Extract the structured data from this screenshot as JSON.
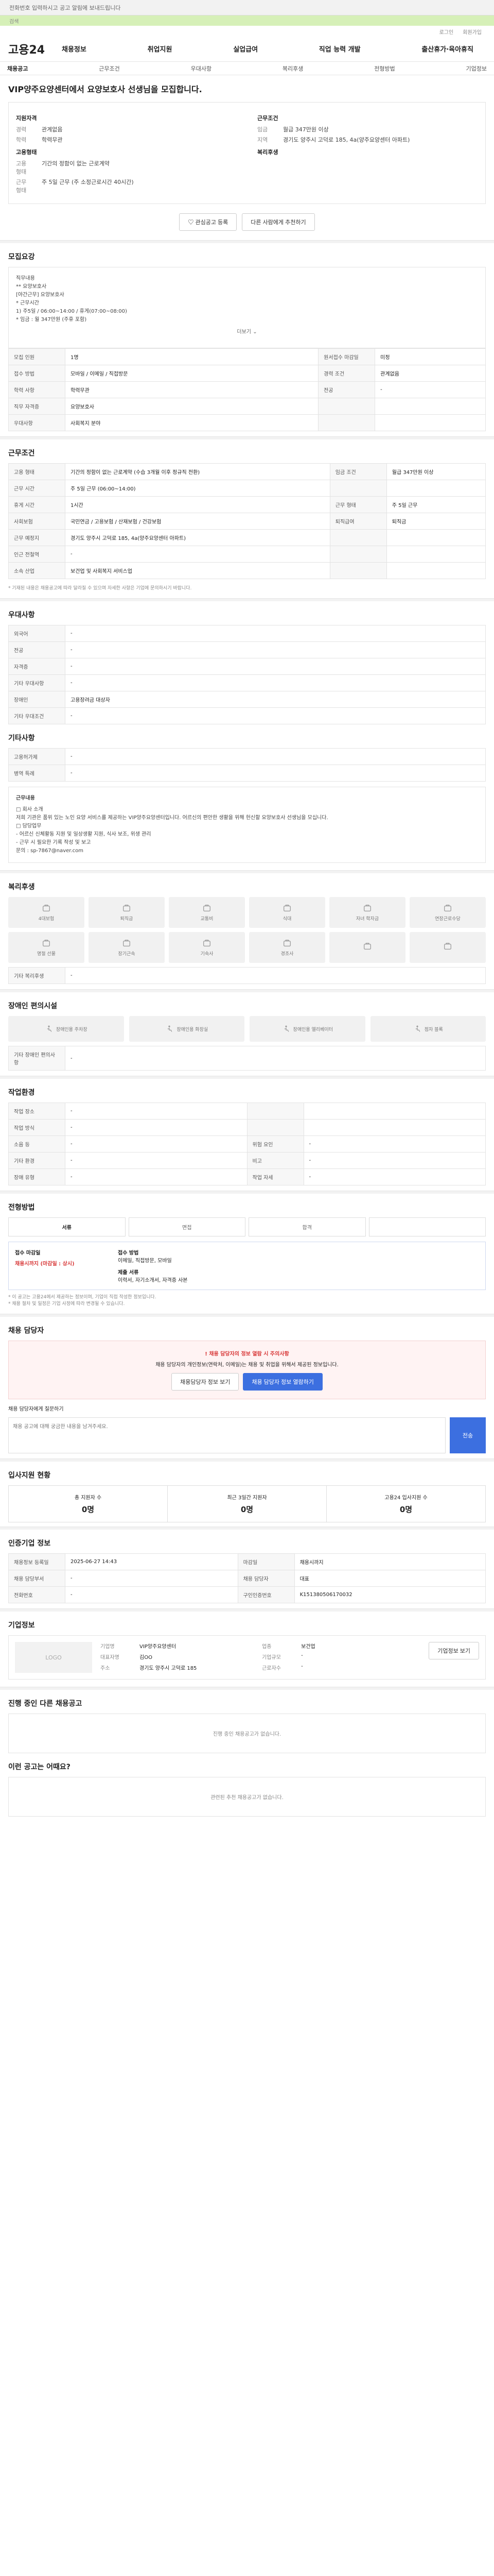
{
  "top": {
    "notice": "전화번호 입력하시고 공고 알림에 보내드립니다",
    "search": "검색"
  },
  "util": [
    "로그인",
    "회원가입"
  ],
  "logo": "고용24",
  "nav": [
    "채용정보",
    "취업지원",
    "실업급여",
    "직업 능력 개발",
    "출산휴가·육아휴직"
  ],
  "tabs": [
    "채용공고",
    "근무조건",
    "우대사항",
    "복리후생",
    "전형방법",
    "기업정보"
  ],
  "job_title": "VIP양주요양센터에서 요양보호사 선생님을 모집합니다.",
  "summary": {
    "left_title": "지원자격",
    "experience_k": "경력",
    "experience": "관계없음",
    "edu_k": "학력",
    "edu": "학력무관",
    "left_title2": "고용형태",
    "type_k": "고용형태",
    "type": "기간의 정함이 없는 근로계약",
    "work_k": "근무형태",
    "work": "주 5일 근무 (주 소정근로시간 40시간)",
    "right_title": "근무조건",
    "wage_k": "임금",
    "wage": "월급 347만원 이상",
    "loc_k": "지역",
    "loc": "경기도 양주시 고덕로 185, 4a(양주요양센터 아파트)",
    "right_title2": "복리후생"
  },
  "actions": {
    "apply": "관심공고 등록",
    "sns": "다른 사람에게 추천하기"
  },
  "recruit": {
    "h": "모집요강",
    "desc": [
      "직무내용",
      "** 요양보호사",
      "[야간근무] 요양보호사",
      "",
      "* 근무시간",
      "1) 주5일 / 06:00~14:00 / 휴게(07:00~08:00)",
      "* 임금 : 월 347만원 (주휴 포함)"
    ],
    "more": "더보기",
    "rows": [
      [
        "모집 인원",
        "1명",
        "원서접수 마감일",
        "미정"
      ],
      [
        "접수 방법",
        "모바일 / 이메일 / 직접방문",
        "경력 조건",
        "관계없음"
      ],
      [
        "학력 사항",
        "학력무관",
        "전공",
        "-"
      ],
      [
        "직무 자격증",
        "요양보호사",
        "",
        ""
      ],
      [
        "우대사항",
        "사회복지 분야",
        "",
        ""
      ]
    ]
  },
  "condition": {
    "h": "근무조건",
    "rows": [
      [
        "고용 형태",
        "기간의 정함이 없는 근로계약 (수습 3개월 이후 정규직 전환)",
        "임금 조건",
        "월급 347만원 이상"
      ],
      [
        "근무 시간",
        "주 5일 근무 (06:00~14:00)",
        "",
        ""
      ],
      [
        "휴게 시간",
        "1시간",
        "근무 형태",
        "주 5일 근무"
      ],
      [
        "사회보험",
        "국민연금 / 고용보험 / 산재보험 / 건강보험",
        "퇴직급여",
        "퇴직금"
      ],
      [
        "근무 예정지",
        "경기도 양주시 고덕로 185, 4a(양주요양센터 아파트)",
        "",
        ""
      ],
      [
        "인근 전철역",
        "-",
        "",
        ""
      ],
      [
        "소속 산업",
        "보건업 및 사회복지 서비스업",
        "",
        ""
      ]
    ],
    "note": "* 기재된 내용은 채용공고에 따라 달라질 수 있으며 자세한 사항은 기업에 문의하시기 바랍니다."
  },
  "pref": {
    "h": "우대사항",
    "rows": [
      [
        "외국어",
        "-"
      ],
      [
        "전공",
        "-"
      ],
      [
        "자격증",
        "-"
      ],
      [
        "기타 우대사항",
        "-"
      ],
      [
        "장애인",
        "고용장려금 대상자"
      ],
      [
        "기타 우대조건",
        "-"
      ]
    ]
  },
  "etc": {
    "h": "기타사항",
    "rows": [
      [
        "고용허가제",
        "-"
      ],
      [
        "병역 특례",
        "-"
      ]
    ]
  },
  "detail": {
    "title": "근무내용",
    "text": [
      "□ 회사 소개",
      "저희 기관은 품위 있는 노인 요양 서비스를 제공하는 VIP양주요양센터입니다. 어르신의 편안한 생활을 위해 헌신할 요양보호사 선생님을 모십니다.",
      "□ 담당업무",
      "- 어르신 신체활동 지원 및 일상생활 지원, 식사 보조, 위생 관리",
      "- 근무 시 필요한 기록 작성 및 보고",
      "문의 : sp-7867@naver.com"
    ]
  },
  "welfare": {
    "h": "복리후생",
    "items": [
      "4대보험",
      "퇴직금",
      "교통비",
      "식대",
      "자녀 학자금",
      "연장근로수당",
      "명절 선물",
      "장기근속",
      "기숙사",
      "경조사",
      "",
      ""
    ],
    "etc_k": "기타 복리후생",
    "etc_v": "-"
  },
  "disabled": {
    "h": "장애인 편의시설",
    "items": [
      "장애인용 주차장",
      "장애인용 화장실",
      "장애인용 엘리베이터",
      "점자 블록"
    ],
    "etc_k": "기타 장애인 편의사항",
    "etc_v": "-"
  },
  "working": {
    "h": "작업환경",
    "rows": [
      [
        "작업 장소",
        "-",
        "",
        ""
      ],
      [
        "작업 방식",
        "-",
        "",
        ""
      ],
      [
        "소음 등",
        "-",
        "위험 요인",
        "-"
      ],
      [
        "기타 환경",
        "-",
        "비고",
        "-"
      ],
      [
        "장애 유형",
        "-",
        "작업 자세",
        "-"
      ]
    ]
  },
  "selection": {
    "h": "전형방법",
    "steps": [
      "서류",
      "면접",
      "합격",
      ""
    ],
    "deadline_k": "접수 마감일",
    "deadline": "채용시까지 (마감일 : 상시)",
    "method_k": "접수 방법",
    "method": "이메일, 직접방문, 모바일",
    "submit_k": "제출 서류",
    "submit": "이력서, 자기소개서, 자격증 사본",
    "notes": [
      "* 이 공고는 고용24에서 제공하는 정보이며, 기업이 직접 작성한 정보입니다.",
      "* 채용 절차 및 일정은 기업 사정에 따라 변경될 수 있습니다."
    ]
  },
  "contact": {
    "h": "채용 담당자",
    "warn_title": "채용 담당자의 정보 열람 시 주의사항",
    "warn_text": "채용 담당자의 개인정보(연락처, 이메일)는 채용 및 취업을 위해서 제공된 정보입니다.",
    "btn1": "채용담당자 정보 보기",
    "btn2": "채용 담당자 정보 열람하기",
    "inq_label": "채용 담당자에게 질문하기",
    "inq_ph": "채용 공고에 대해 궁금한 내용을 남겨주세요.",
    "send": "전송"
  },
  "stats": {
    "h": "입사지원 현황",
    "a": [
      "총 지원자 수",
      "0명"
    ],
    "b": [
      "최근 3일간 지원자",
      "0명"
    ],
    "c": [
      "고용24 입사지원 수",
      "0명"
    ]
  },
  "reg": {
    "h": "인증기업 정보",
    "rows": [
      [
        "채용정보 등록일",
        "2025-06-27 14:43",
        "마감일",
        "채용시까지"
      ],
      [
        "채용 담당부서",
        "-",
        "채용 담당자",
        "대표"
      ],
      [
        "전화번호",
        "-",
        "구인인증번호",
        "K151380506170032"
      ]
    ]
  },
  "company": {
    "h": "기업정보",
    "logo": "LOGO",
    "rows": [
      [
        "기업명",
        "VIP양주요양센터",
        "업종",
        "보건업"
      ],
      [
        "대표자명",
        "김OO",
        "기업규모",
        "-"
      ],
      [
        "주소",
        "경기도 양주시 고덕로 185",
        "근로자수",
        "-"
      ]
    ],
    "btn": "기업정보 보기"
  },
  "other": {
    "h": "진행 중인 다른 채용공고",
    "empty": "진행 중인 채용공고가 없습니다."
  },
  "recommend": {
    "h": "이런 공고는 어때요?",
    "empty": "관련된 추천 채용공고가 없습니다."
  }
}
